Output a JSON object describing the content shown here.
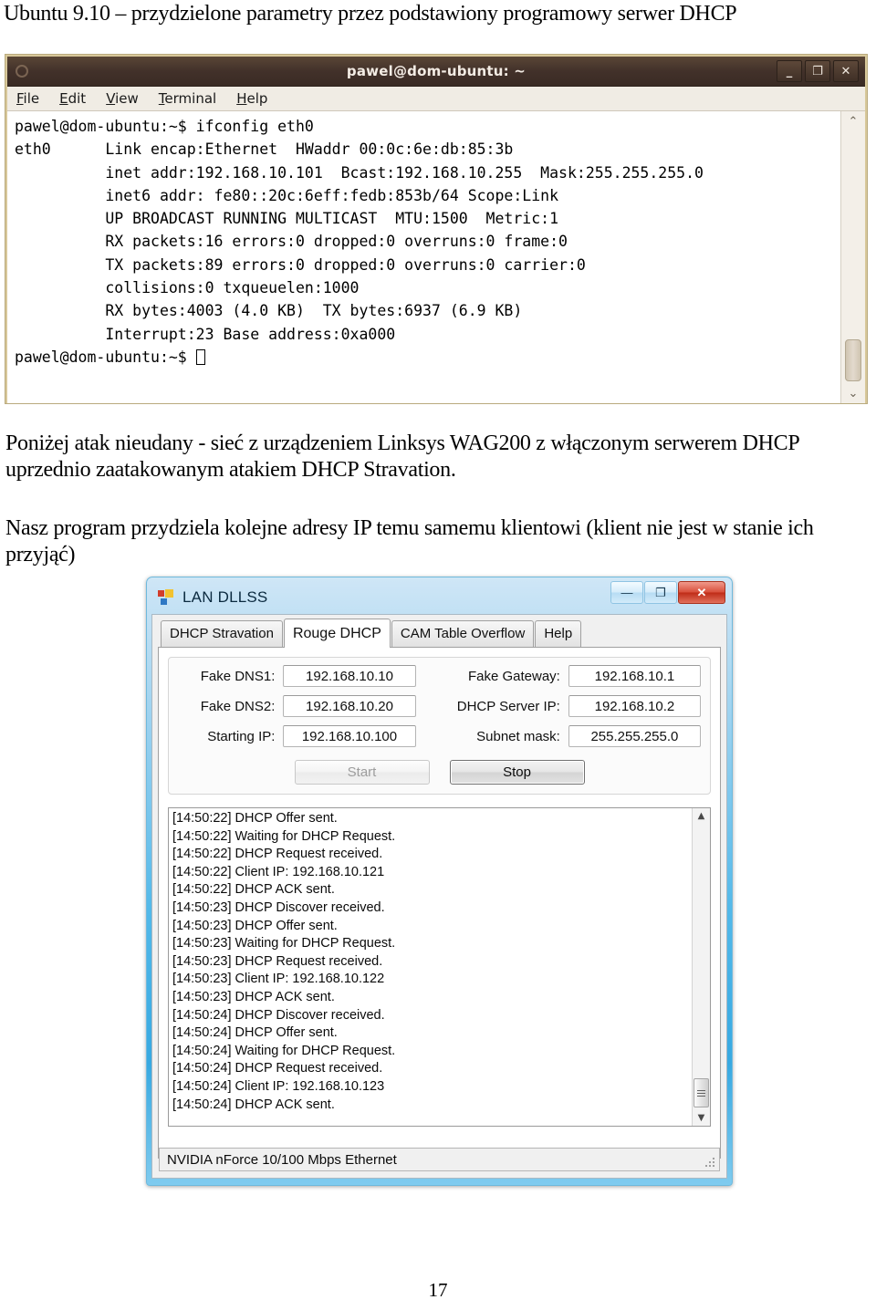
{
  "document": {
    "heading": "Ubuntu 9.10 – przydzielone parametry przez podstawiony programowy serwer DHCP",
    "paragraph_1": "Poniżej atak nieudany - sieć z urządzeniem Linksys WAG200 z włączonym serwerem DHCP  uprzednio zaatakowanym atakiem DHCP Stravation.",
    "paragraph_2": "Nasz program przydziela kolejne adresy IP temu samemu klientowi (klient nie jest w stanie ich przyjąć)",
    "page_number": "17"
  },
  "terminal": {
    "title": "pawel@dom-ubuntu: ~",
    "menu": [
      {
        "label": "File",
        "accel": "F"
      },
      {
        "label": "Edit",
        "accel": "E"
      },
      {
        "label": "View",
        "accel": "V"
      },
      {
        "label": "Terminal",
        "accel": "T"
      },
      {
        "label": "Help",
        "accel": "H"
      }
    ],
    "window_buttons": {
      "minimize": "_",
      "maximize": "❐",
      "close": "✕"
    },
    "output": "pawel@dom-ubuntu:~$ ifconfig eth0\neth0      Link encap:Ethernet  HWaddr 00:0c:6e:db:85:3b\n          inet addr:192.168.10.101  Bcast:192.168.10.255  Mask:255.255.255.0\n          inet6 addr: fe80::20c:6eff:fedb:853b/64 Scope:Link\n          UP BROADCAST RUNNING MULTICAST  MTU:1500  Metric:1\n          RX packets:16 errors:0 dropped:0 overruns:0 frame:0\n          TX packets:89 errors:0 dropped:0 overruns:0 carrier:0\n          collisions:0 txqueuelen:1000\n          RX bytes:4003 (4.0 KB)  TX bytes:6937 (6.9 KB)\n          Interrupt:23 Base address:0xa000\n",
    "prompt": "pawel@dom-ubuntu:~$ ",
    "scrollbar": {
      "up_arrow": "⌃",
      "down_arrow": "⌄"
    },
    "colors": {
      "titlebar": "#42312a",
      "background": "#ffffff",
      "text": "#000000",
      "border": "#d8c89a"
    }
  },
  "lan_app": {
    "title": "LAN DLLSS",
    "window_buttons": {
      "minimize": "—",
      "maximize": "❐",
      "close": "✕"
    },
    "tabs": [
      {
        "label": "DHCP Stravation",
        "active": false
      },
      {
        "label": "Rouge DHCP",
        "active": true
      },
      {
        "label": "CAM Table Overflow",
        "active": false
      },
      {
        "label": "Help",
        "active": false
      }
    ],
    "fields": [
      {
        "label": "Fake DNS1:",
        "value": "192.168.10.10"
      },
      {
        "label": "Fake Gateway:",
        "value": "192.168.10.1"
      },
      {
        "label": "Fake DNS2:",
        "value": "192.168.10.20"
      },
      {
        "label": "DHCP Server IP:",
        "value": "192.168.10.2"
      },
      {
        "label": "Starting IP:",
        "value": "192.168.10.100"
      },
      {
        "label": "Subnet mask:",
        "value": "255.255.255.0"
      }
    ],
    "buttons": {
      "start": "Start",
      "stop": "Stop"
    },
    "log": [
      "[14:50:22] DHCP Offer sent.",
      "[14:50:22] Waiting for DHCP Request.",
      "[14:50:22] DHCP Request received.",
      "[14:50:22] Client IP: 192.168.10.121",
      "[14:50:22] DHCP ACK sent.",
      "[14:50:23] DHCP Discover received.",
      "[14:50:23] DHCP Offer sent.",
      "[14:50:23] Waiting for DHCP Request.",
      "[14:50:23] DHCP Request received.",
      "[14:50:23] Client IP: 192.168.10.122",
      "[14:50:23] DHCP ACK sent.",
      "[14:50:24] DHCP Discover received.",
      "[14:50:24] DHCP Offer sent.",
      "[14:50:24] Waiting for DHCP Request.",
      "[14:50:24] DHCP Request received.",
      "[14:50:24] Client IP: 192.168.10.123",
      "[14:50:24] DHCP ACK sent."
    ],
    "log_scrollbar": {
      "up_arrow": "▲",
      "down_arrow": "▼"
    },
    "statusbar": "NVIDIA nForce 10/100 Mbps Ethernet",
    "colors": {
      "titlebar_accent": "#37a9e2",
      "close_button": "#bf2d18",
      "client_bg": "#f0f0f0"
    }
  }
}
